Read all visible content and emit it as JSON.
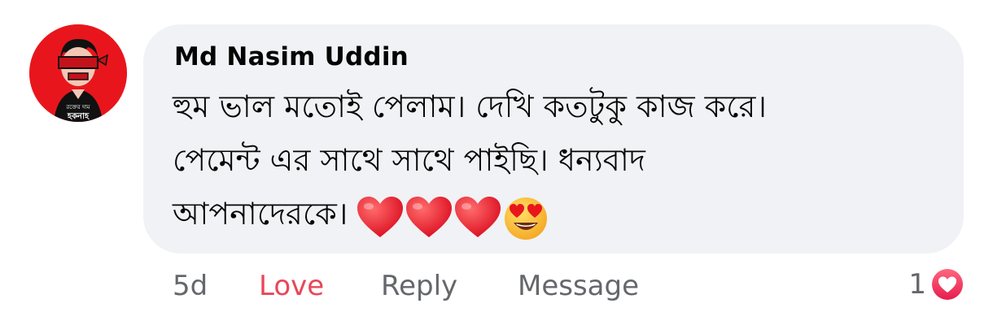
{
  "comment": {
    "author": "Md Nasim Uddin",
    "lines": [
      "হুম ভাল মতোই পেলাম। দেখি কতটুকু কাজ করে।",
      "পেমেন্ট এর সাথে সাথে পাইছি। ধন্যবাদ",
      "আপনাদেরকে।"
    ],
    "emojis": [
      "heart-emoji",
      "heart-emoji",
      "heart-emoji",
      "heart-eyes-emoji"
    ],
    "avatar_icon": "profile-avatar-blindfolded-man"
  },
  "actions": {
    "time": "5d",
    "love_label": "Love",
    "reply_label": "Reply",
    "message_label": "Message"
  },
  "reactions": {
    "count": "1",
    "icon": "love-reaction-icon"
  },
  "colors": {
    "bubble": "#f0f2f5",
    "love_accent": "#e8475a",
    "avatar_bg": "#e8161c",
    "muted_text": "#65676b"
  }
}
